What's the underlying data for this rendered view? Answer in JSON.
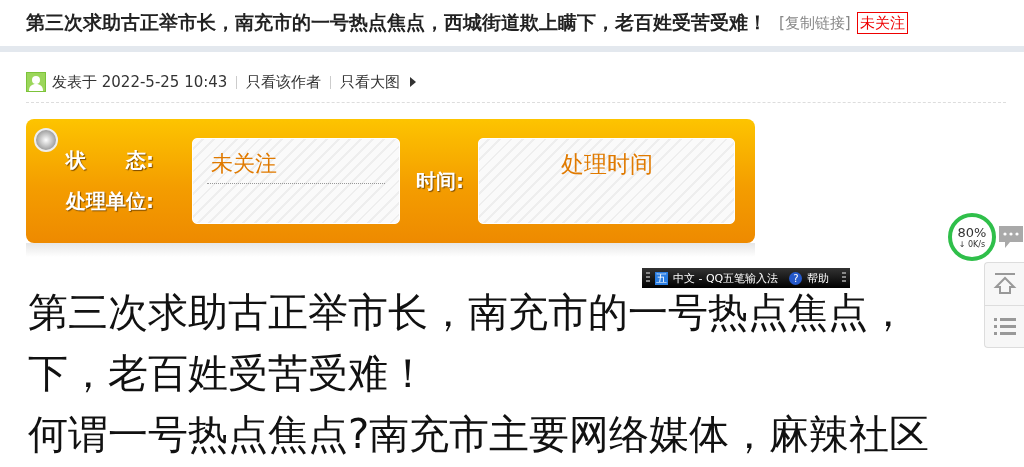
{
  "header": {
    "title": "第三次求助古正举市长，南充市的一号热点焦点，西城街道欺上瞒下，老百姓受苦受难！",
    "copy_link": "[复制链接]",
    "status_badge": "未关注"
  },
  "meta": {
    "posted": "发表于 2022-5-25 10:43",
    "links": [
      "只看该作者",
      "只看大图"
    ]
  },
  "status_panel": {
    "status_label": "状　　态:",
    "unit_label": "处理单位:",
    "status_value": "未关注",
    "time_label": "时间:",
    "time_value": "处理时间"
  },
  "body_lines": [
    "第三次求助古正举市长，南充市的一号热点焦点，",
    "下，老百姓受苦受难！",
    "何谓一号热点焦点?南充市主要网络媒体，麻辣社区"
  ],
  "ime_bar": {
    "mode_key": "五",
    "name": "中文 - QQ五笔输入法",
    "help_key": "?",
    "help": "帮助"
  },
  "speed_widget": {
    "percent": "80%",
    "speed": "↓ 0K/s"
  }
}
